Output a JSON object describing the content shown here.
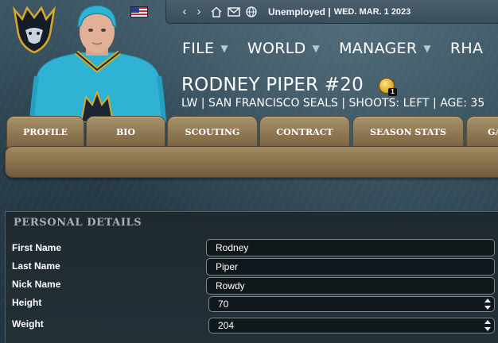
{
  "topbar": {
    "flag_icon": "us-flag-icon",
    "status": "Unemployed |",
    "date": "WED. MAR. 1 2023"
  },
  "menu": {
    "items": [
      {
        "label": "FILE"
      },
      {
        "label": "WORLD"
      },
      {
        "label": "MANAGER"
      },
      {
        "label": "RHA"
      }
    ]
  },
  "player": {
    "name": "RODNEY PIPER #20",
    "badge_count": "1",
    "info": "LW | SAN FRANCISCO SEALS | SHOOTS: LEFT | AGE: 35"
  },
  "tabs": [
    {
      "label": "PROFILE"
    },
    {
      "label": "BIO"
    },
    {
      "label": "SCOUTING"
    },
    {
      "label": "CONTRACT"
    },
    {
      "label": "SEASON STATS"
    },
    {
      "label": "GA"
    }
  ],
  "personal_details": {
    "title": "PERSONAL DETAILS",
    "first_name": {
      "label": "First Name",
      "value": "Rodney"
    },
    "last_name": {
      "label": "Last Name",
      "value": "Piper"
    },
    "nick_name": {
      "label": "Nick Name",
      "value": "Rowdy"
    },
    "height": {
      "label": "Height",
      "value": "70"
    },
    "weight": {
      "label": "Weight",
      "value": "204"
    }
  },
  "colors": {
    "jersey": "#2fb2d4",
    "trim": "#d8a928",
    "tab": "#8c7551",
    "panel": "#1f2a30"
  }
}
